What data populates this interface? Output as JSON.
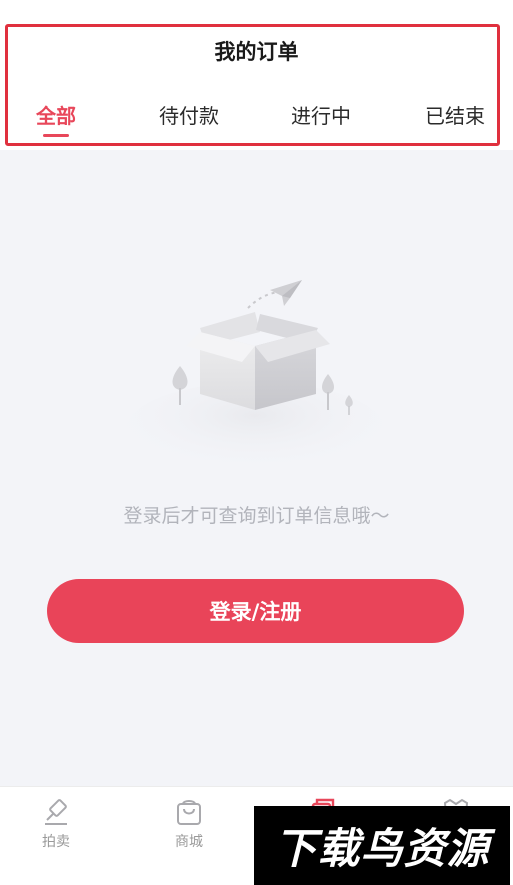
{
  "header": {
    "title": "我的订单",
    "tabs": [
      {
        "label": "全部",
        "active": true
      },
      {
        "label": "待付款",
        "active": false
      },
      {
        "label": "进行中",
        "active": false
      },
      {
        "label": "已结束",
        "active": false
      }
    ]
  },
  "empty_state": {
    "illustration": "empty-box-icon",
    "message": "登录后才可查询到订单信息哦～",
    "button_label": "登录/注册"
  },
  "bottom_nav": {
    "items": [
      {
        "label": "拍卖",
        "icon": "gavel-icon",
        "active": false
      },
      {
        "label": "商城",
        "icon": "shopping-bag-icon",
        "active": false
      },
      {
        "label": "",
        "icon": "orders-icon",
        "active": true
      },
      {
        "label": "",
        "icon": "profile-icon",
        "active": false
      }
    ]
  },
  "watermark": {
    "text": "下载鸟资源"
  },
  "colors": {
    "accent": "#e8475a",
    "button": "#e94459",
    "highlight_border": "#e0303e",
    "background": "#f3f4f8",
    "muted_text": "#b2b4bb"
  }
}
